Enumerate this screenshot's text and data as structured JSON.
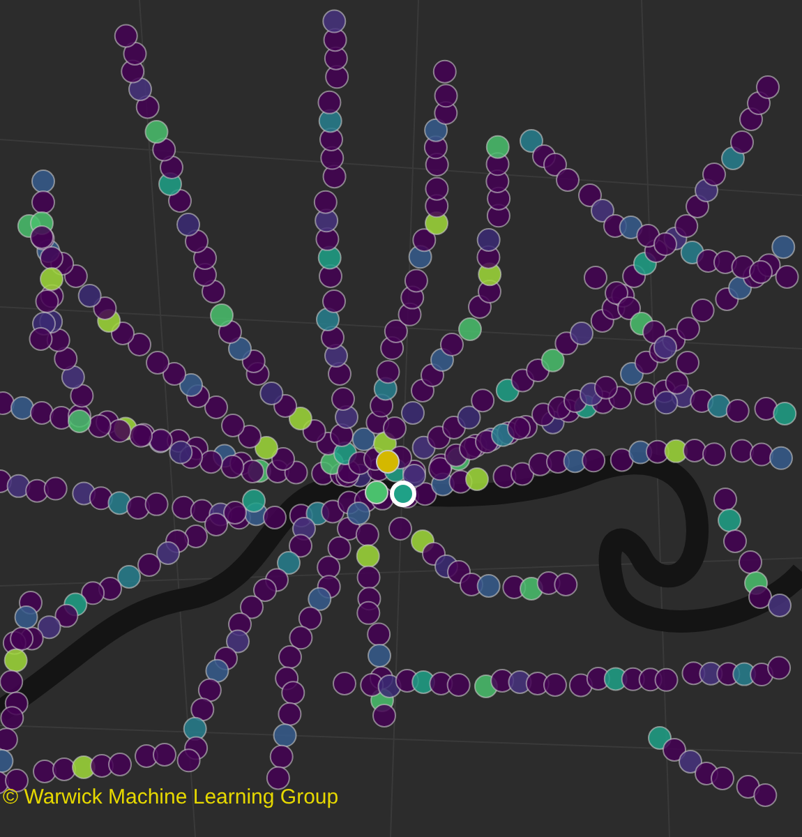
{
  "map": {
    "attribution": "© Warwick Machine Learning Group"
  }
}
